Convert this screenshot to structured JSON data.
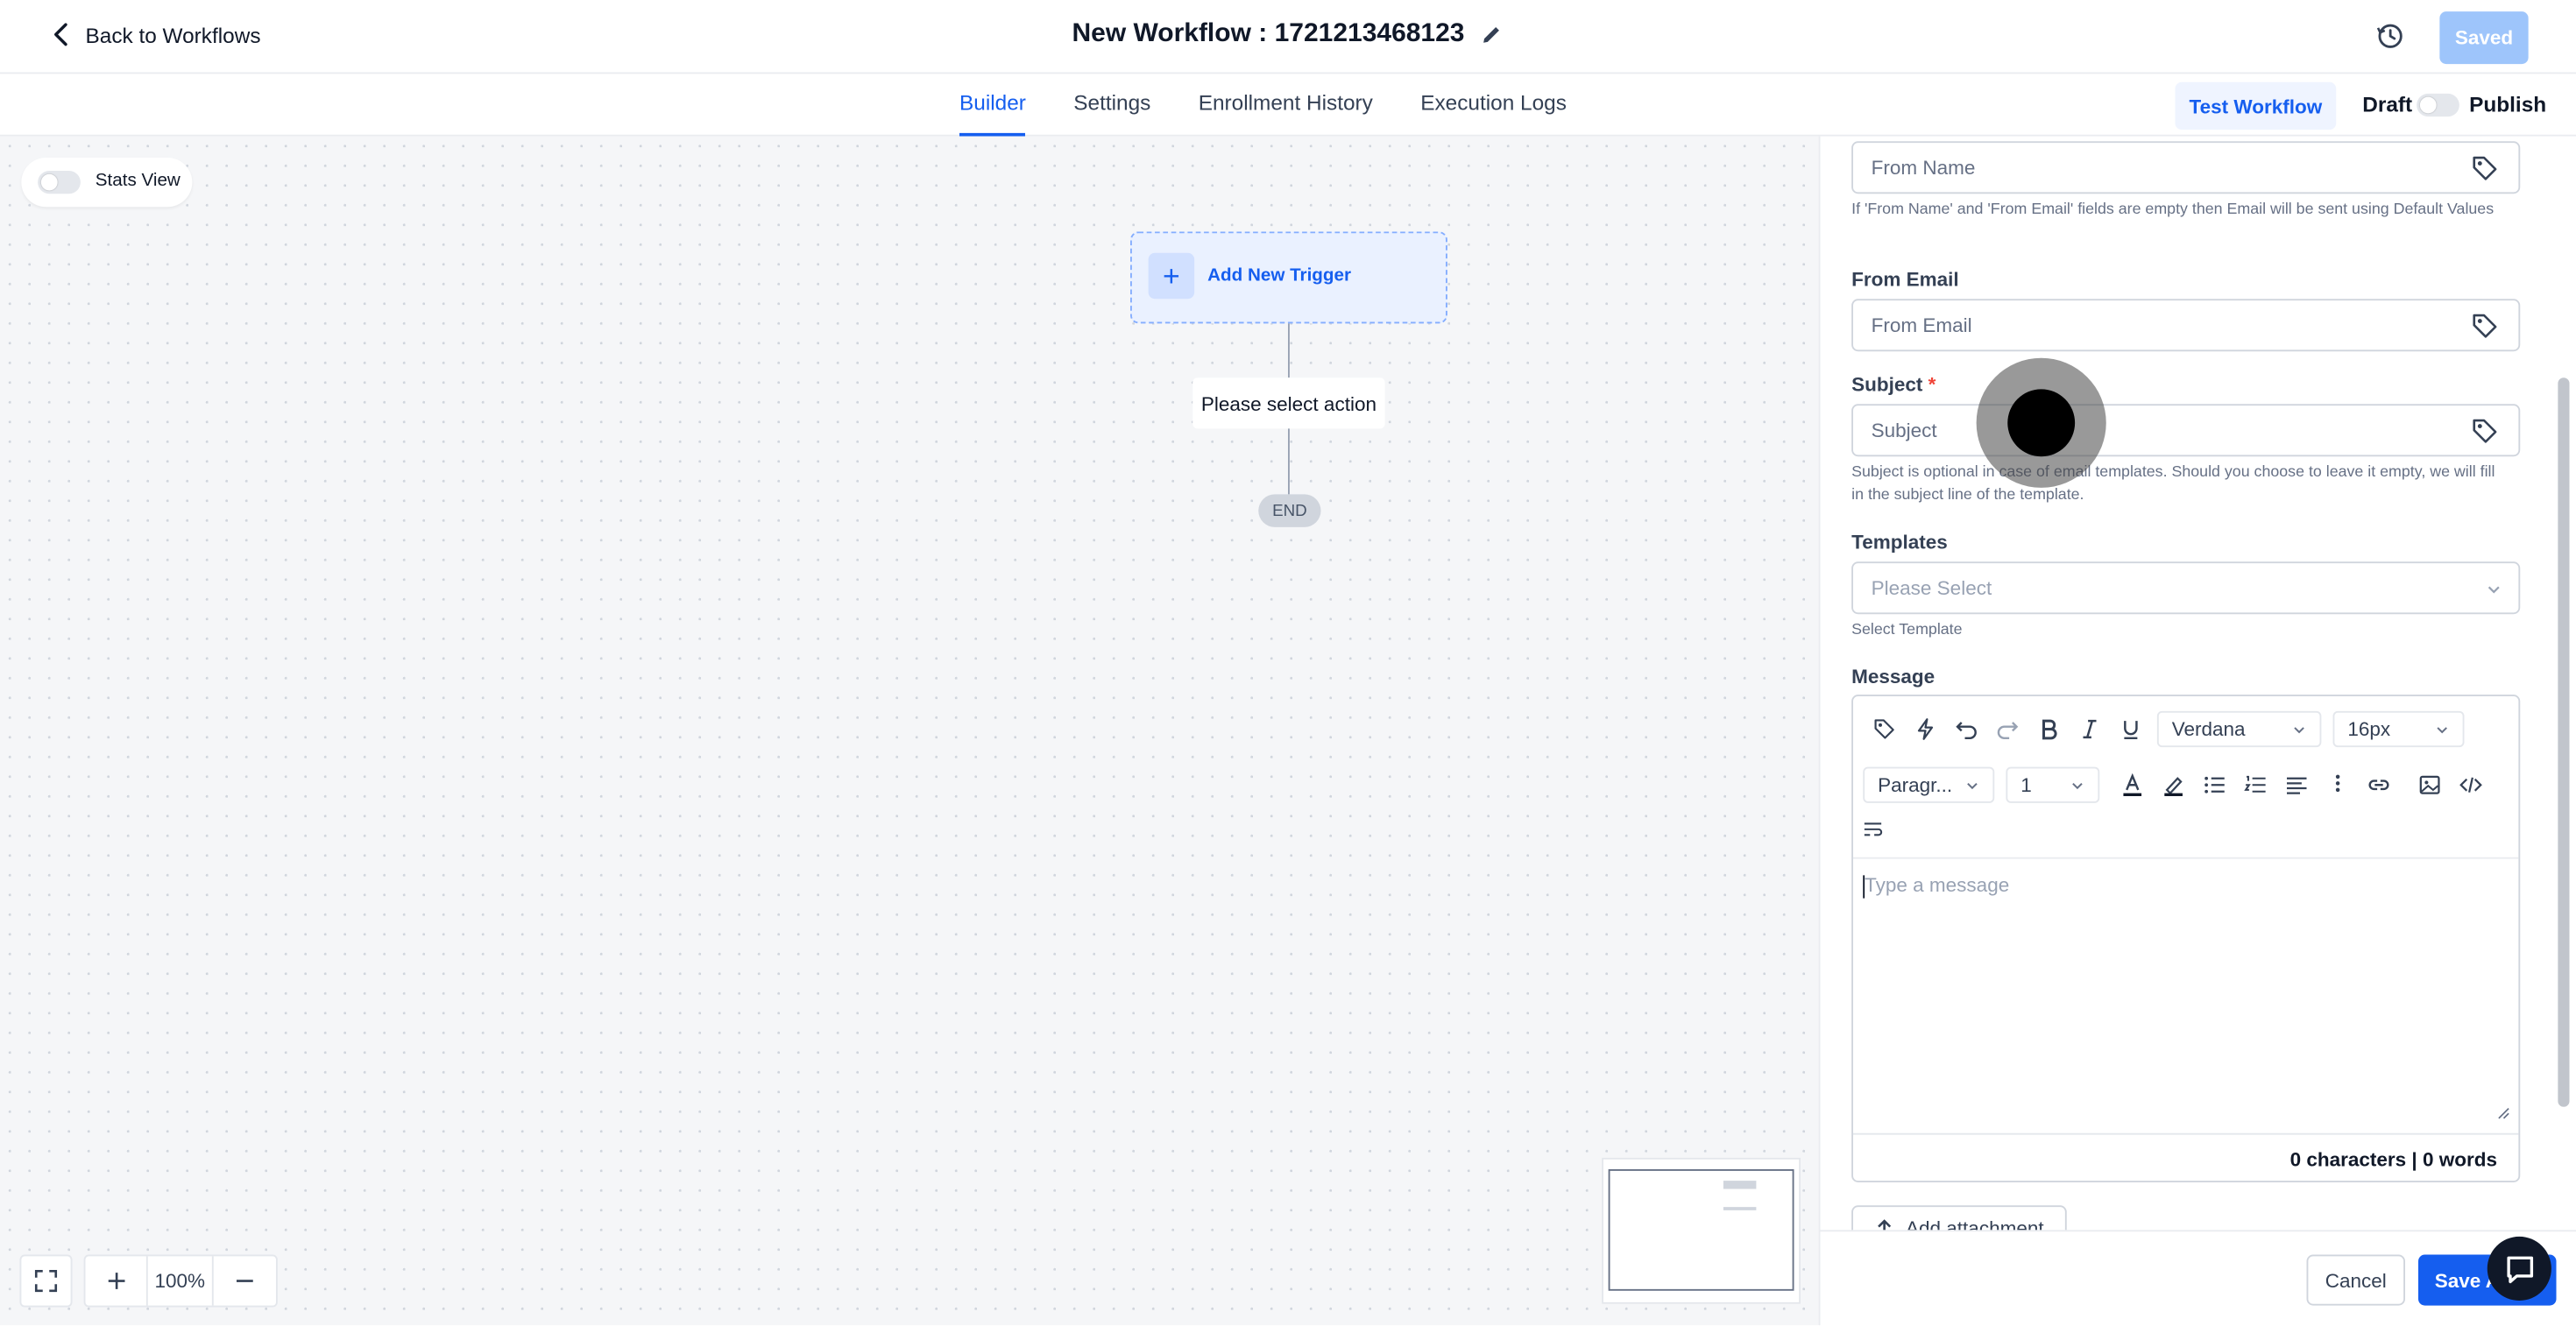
{
  "header": {
    "back_label": "Back to Workflows",
    "title": "New Workflow : 1721213468123",
    "saved_label": "Saved"
  },
  "tabs": [
    {
      "label": "Builder",
      "active": true
    },
    {
      "label": "Settings",
      "active": false
    },
    {
      "label": "Enrollment History",
      "active": false
    },
    {
      "label": "Execution Logs",
      "active": false
    }
  ],
  "actions": {
    "test_label": "Test Workflow",
    "draft_label": "Draft",
    "publish_label": "Publish",
    "publish_enabled": false
  },
  "canvas": {
    "stats_label": "Stats View",
    "stats_enabled": false,
    "trigger_label": "Add New Trigger",
    "action_label": "Please select action",
    "end_label": "END",
    "zoom_level": "100%"
  },
  "panel": {
    "from_name_placeholder": "From Name",
    "from_help": "If 'From Name' and 'From Email' fields are empty then Email will be sent using Default Values",
    "from_email_label": "From Email",
    "from_email_placeholder": "From Email",
    "subject_label": "Subject",
    "subject_required": "*",
    "subject_placeholder": "Subject",
    "subject_help": "Subject is optional in case of email templates. Should you choose to leave it empty, we will fill in the subject line of the template.",
    "templates_label": "Templates",
    "templates_placeholder": "Please Select",
    "templates_help": "Select Template",
    "message_label": "Message",
    "font_family": "Verdana",
    "font_size": "16px",
    "block_format": "Paragr...",
    "line_height": "1",
    "message_placeholder": "Type a message",
    "counts": "0 characters | 0 words",
    "attach_label": "Add attachment",
    "cancel_label": "Cancel",
    "save_label": "Save A"
  },
  "colors": {
    "accent": "#155eef",
    "saved_disabled": "#9ec5fb",
    "required": "#f04438"
  }
}
